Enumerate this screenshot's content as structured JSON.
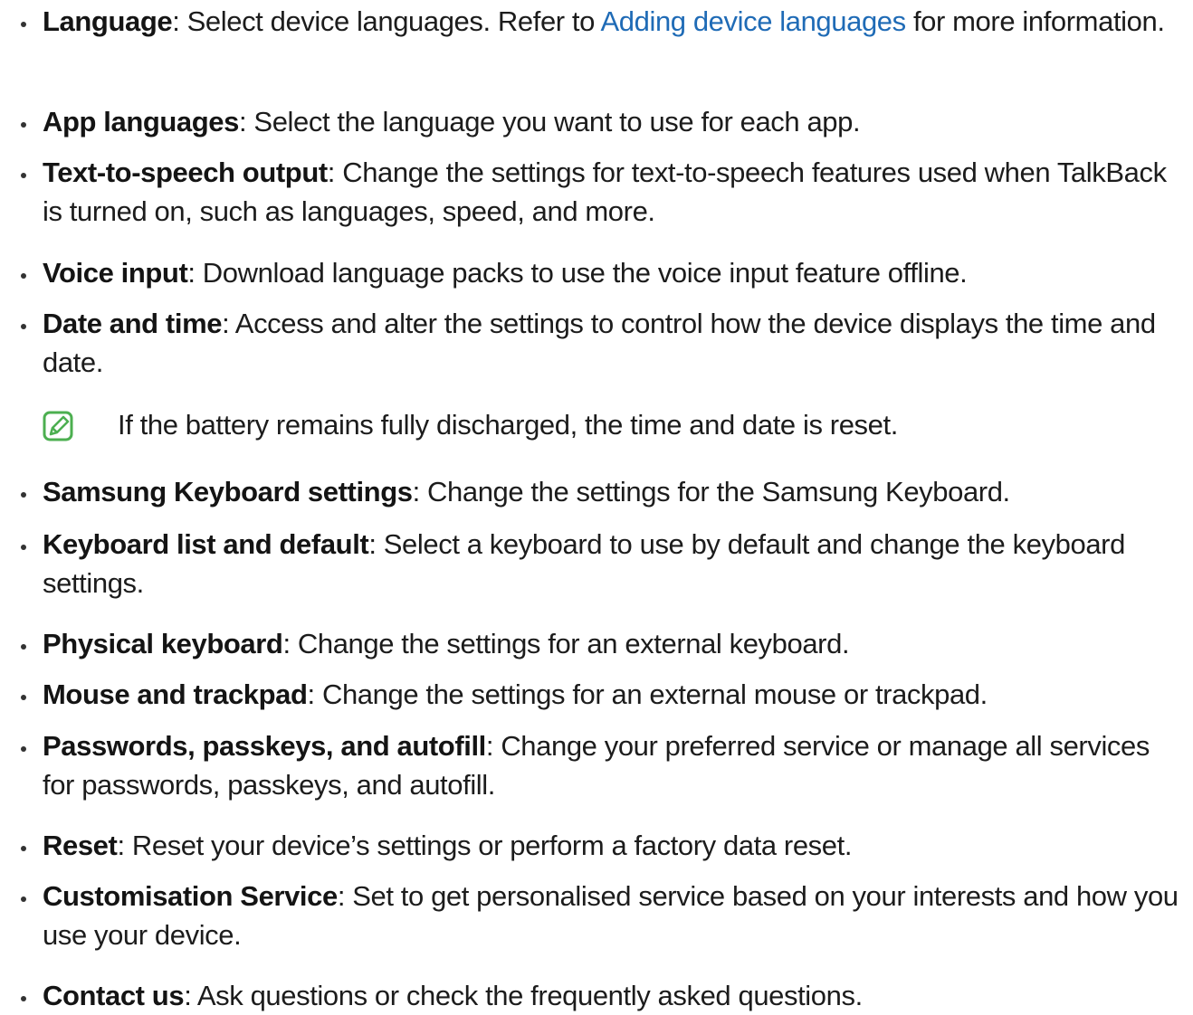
{
  "items": [
    {
      "term": "Language",
      "pre": ": Select device languages. Refer to ",
      "link": "Adding device languages",
      "post": " for more information."
    },
    {
      "term": "App languages",
      "desc": ": Select the language you want to use for each app."
    },
    {
      "term": "Text-to-speech output",
      "desc": ": Change the settings for text-to-speech features used when TalkBack is turned on, such as languages, speed, and more."
    },
    {
      "term": "Voice input",
      "desc": ": Download language packs to use the voice input feature offline."
    },
    {
      "term": "Date and time",
      "desc": ": Access and alter the settings to control how the device displays the time and date."
    },
    {
      "term": "Samsung Keyboard settings",
      "desc": ": Change the settings for the Samsung Keyboard."
    },
    {
      "term": "Keyboard list and default",
      "desc": ": Select a keyboard to use by default and change the keyboard settings."
    },
    {
      "term": "Physical keyboard",
      "desc": ": Change the settings for an external keyboard."
    },
    {
      "term": "Mouse and trackpad",
      "desc": ": Change the settings for an external mouse or trackpad."
    },
    {
      "term": "Passwords, passkeys, and autofill",
      "desc": ": Change your preferred service or manage all services for passwords, passkeys, and autofill."
    },
    {
      "term": "Reset",
      "desc": ": Reset your device’s settings or perform a factory data reset."
    },
    {
      "term": "Customisation Service",
      "desc": ": Set to get personalised service based on your interests and how you use your device."
    },
    {
      "term": "Contact us",
      "desc": ": Ask questions or check the frequently asked questions."
    }
  ],
  "note": {
    "icon": "note-icon",
    "text": "If the battery remains fully discharged, the time and date is reset."
  },
  "colors": {
    "link": "#1f6bb6",
    "note_icon": "#4caf50",
    "text": "#1c1c1c"
  }
}
